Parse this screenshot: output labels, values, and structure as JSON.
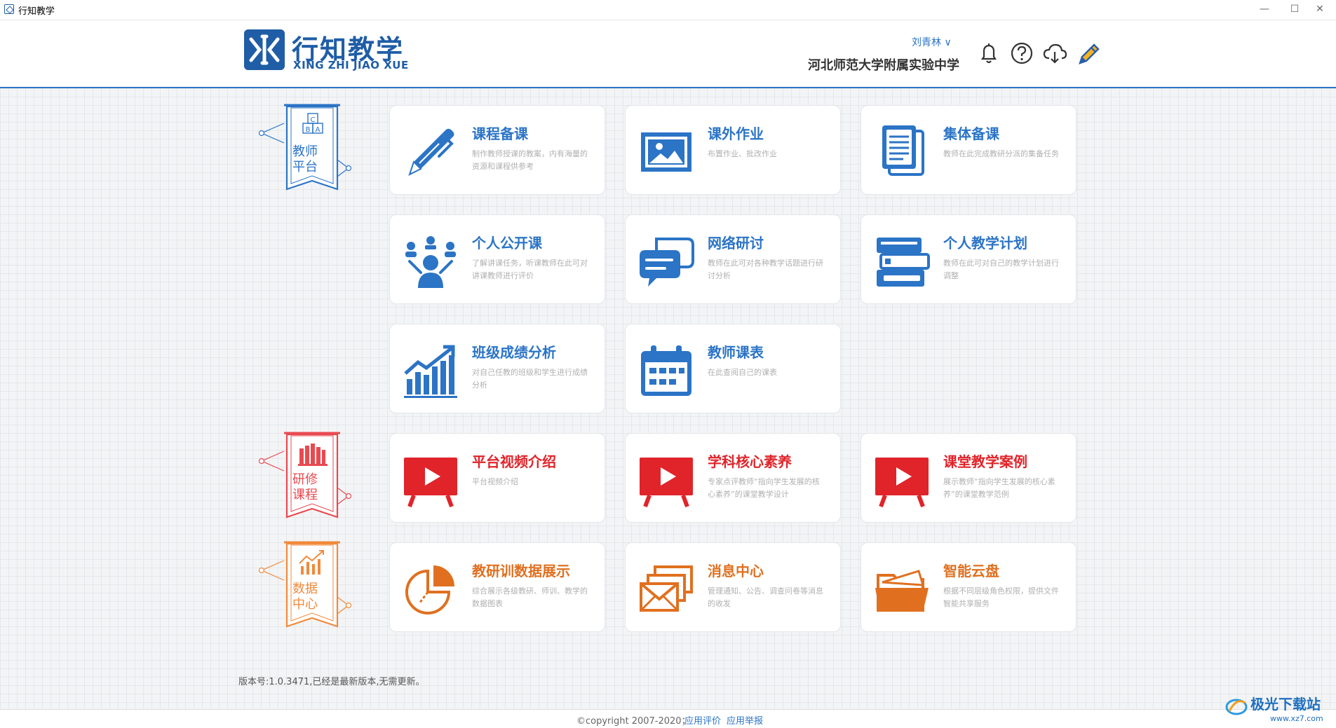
{
  "window": {
    "title": "行知教学",
    "minimize": "—",
    "maximize": "☐",
    "close": "✕"
  },
  "header": {
    "logo_title": "行知教学",
    "logo_sub": "XING ZHI JIAO XUE",
    "user": "刘青林 ∨",
    "school": "河北师范大学附属实验中学"
  },
  "sections": [
    {
      "line1": "教师",
      "line2": "平台",
      "color": "#2b74c6"
    },
    {
      "line1": "研修",
      "line2": "课程",
      "color": "#e84a50"
    },
    {
      "line1": "数据",
      "line2": "中心",
      "color": "#f08a3c"
    }
  ],
  "ribbon_blocks": [
    "C",
    "B",
    "A"
  ],
  "cards": [
    {
      "title": "课程备课",
      "desc": "制作教师授课的教案，内有海量的资源和课程供参考",
      "icon": "pen-icon"
    },
    {
      "title": "课外作业",
      "desc": "布置作业、批改作业",
      "icon": "image-icon"
    },
    {
      "title": "集体备课",
      "desc": "教师在此完成教研分派的集备任务",
      "icon": "documents-icon"
    },
    {
      "title": "个人公开课",
      "desc": "了解讲课任务，听课教师在此可对讲课教师进行评价",
      "icon": "group-icon"
    },
    {
      "title": "网络研讨",
      "desc": "教师在此可对各种教学话题进行研讨分析",
      "icon": "chat-icon"
    },
    {
      "title": "个人教学计划",
      "desc": "教师在此可对自己的教学计划进行调整",
      "icon": "books-icon"
    },
    {
      "title": "班级成绩分析",
      "desc": "对自己任教的班级和学生进行成绩分析",
      "icon": "growth-chart-icon"
    },
    {
      "title": "教师课表",
      "desc": "在此查阅自己的课表",
      "icon": "calendar-icon"
    },
    {
      "title": "平台视频介绍",
      "desc": "平台视频介绍",
      "icon": "video-icon"
    },
    {
      "title": "学科核心素养",
      "desc": "专家点评教师“指向学生发展的核心素养”的课堂教学设计",
      "icon": "video-icon"
    },
    {
      "title": "课堂教学案例",
      "desc": "展示教师“指向学生发展的核心素养”的课堂教学范例",
      "icon": "video-icon"
    },
    {
      "title": "教研训数据展示",
      "desc": "综合展示各级教研、师训、教学的数据图表",
      "icon": "pie-chart-icon"
    },
    {
      "title": "消息中心",
      "desc": "管理通知、公告、调查问卷等消息的收发",
      "icon": "mail-icon"
    },
    {
      "title": "智能云盘",
      "desc": "根据不同层级角色权限，提供文件智能共享服务",
      "icon": "folder-icon"
    }
  ],
  "version": "版本号:1.0.3471,已经是最新版本,无需更新。",
  "footer": {
    "copyright": "©copyright 2007-2020；",
    "link1": "应用评价",
    "link2": "应用举报"
  },
  "watermark": {
    "text": "极光下载站",
    "url": "www.xz7.com"
  },
  "colors": {
    "blue": "#2b74c6",
    "red": "#e0242a",
    "orange": "#e07020"
  }
}
